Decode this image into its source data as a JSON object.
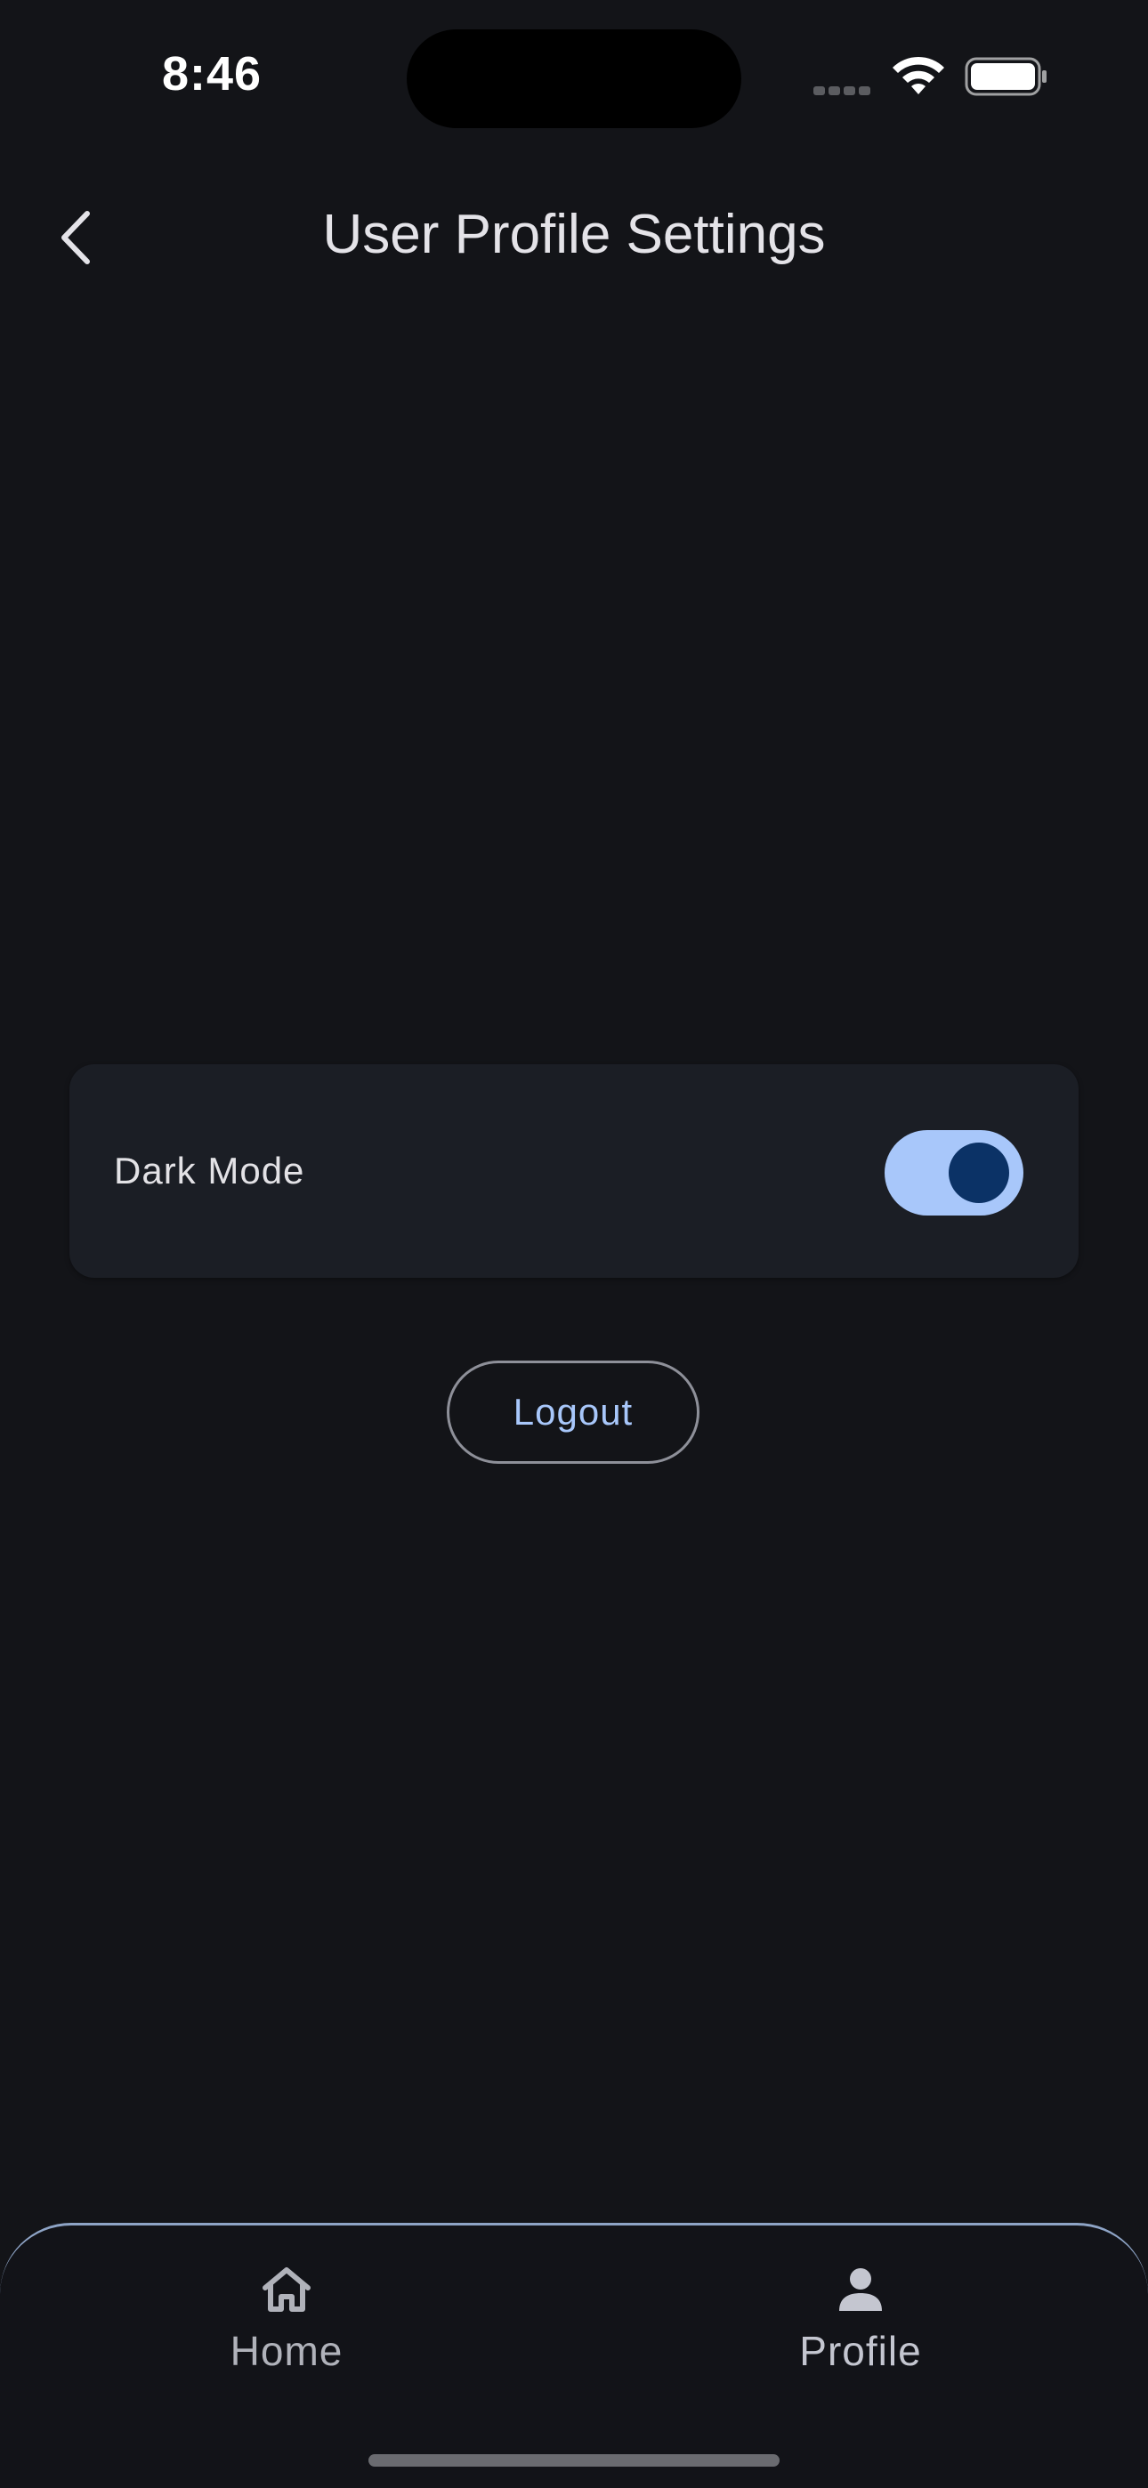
{
  "status_bar": {
    "time": "8:46"
  },
  "app_bar": {
    "title": "User Profile Settings",
    "back_icon": "chevron-left-icon"
  },
  "settings": {
    "dark_mode_label": "Dark Mode",
    "dark_mode_enabled": true
  },
  "actions": {
    "logout_label": "Logout"
  },
  "bottom_nav": {
    "items": [
      {
        "label": "Home",
        "icon": "home-icon"
      },
      {
        "label": "Profile",
        "icon": "person-icon"
      }
    ]
  },
  "colors": {
    "background": "#131418",
    "card": "#1b1e25",
    "accent": "#a8c7fa",
    "toggle_knob": "#0b3266"
  }
}
